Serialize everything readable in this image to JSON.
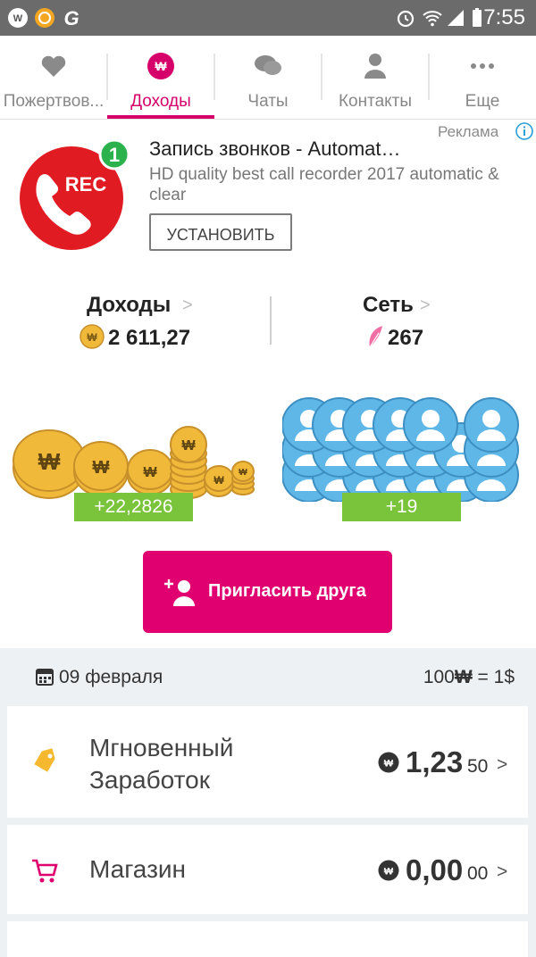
{
  "status_bar": {
    "time": "7:55"
  },
  "tabs": [
    {
      "label": "Пожертвов...",
      "icon": "hands-heart-icon",
      "active": false
    },
    {
      "label": "Доходы",
      "icon": "won-coin-icon",
      "active": true
    },
    {
      "label": "Чаты",
      "icon": "chat-bubbles-icon",
      "active": false
    },
    {
      "label": "Контакты",
      "icon": "person-icon",
      "active": false
    },
    {
      "label": "Еще",
      "icon": "more-dots-icon",
      "active": false
    }
  ],
  "ad": {
    "label": "Реклама",
    "logo_text": "REC",
    "logo_badge": "1",
    "title": "Запись звонков - Automat…",
    "description": "HD quality best call recorder 2017 automatic & clear",
    "install_label": "УСТАНОВИТЬ"
  },
  "stats": {
    "income_title": "Доходы",
    "income_value": "2 611,27",
    "network_title": "Сеть",
    "network_value": "267",
    "income_delta": "+22,2826",
    "network_delta": "+19",
    "chevron": ">"
  },
  "invite": {
    "label": "Пригласить друга"
  },
  "date_row": {
    "date": "09 февраля",
    "rate_prefix": "100",
    "rate_symbol": "₩",
    "rate_suffix": " = 1$"
  },
  "cards": [
    {
      "label_line1": "Мгновенный",
      "label_line2": "Заработок",
      "amount": "1,23",
      "cents": "50",
      "icon": "tag-icon"
    },
    {
      "label_line1": "Магазин",
      "amount": "0,00",
      "cents": "00",
      "icon": "shopping-cart-icon"
    }
  ],
  "colors": {
    "accent": "#e0006f",
    "badge_green": "#79c43b",
    "coin_gold": "#f0b93a",
    "avatar_blue": "#5fb7e8",
    "status_bar": "#6b6b6b"
  }
}
